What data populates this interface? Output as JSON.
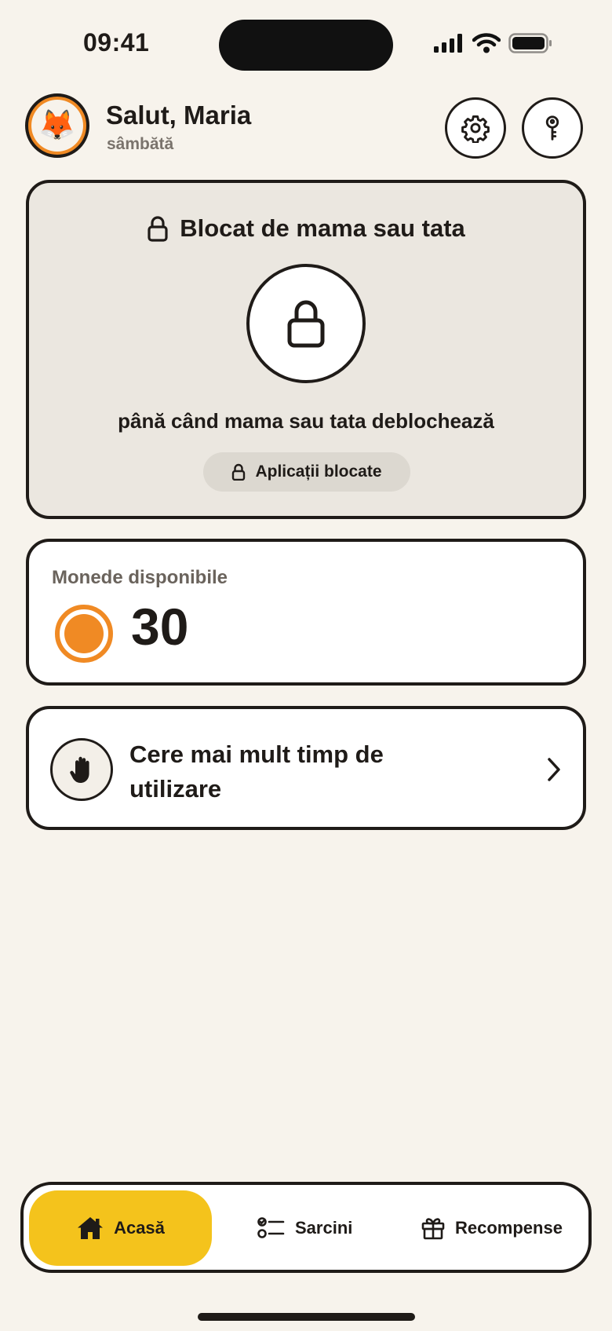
{
  "status_bar": {
    "time": "09:41",
    "icons": [
      "cellular-signal-icon",
      "wifi-icon",
      "battery-icon"
    ]
  },
  "header": {
    "avatar_emoji": "🦊",
    "greeting": "Salut, Maria",
    "day": "sâmbătă",
    "buttons": [
      "settings-icon",
      "key-icon"
    ]
  },
  "lock_card": {
    "title": "Blocat de mama sau tata",
    "message": "până când mama sau tata deblochează",
    "blocked_apps_label": "Aplicații blocate"
  },
  "coins_card": {
    "label": "Monede disponibile",
    "value": "30"
  },
  "request_card": {
    "label": "Cere mai mult timp de utilizare"
  },
  "nav": {
    "home": "Acasă",
    "tasks": "Sarcini",
    "rewards": "Recompense",
    "active": "home"
  },
  "colors": {
    "background": "#f7f3ec",
    "accent_yellow": "#f4c31c",
    "coin_orange": "#f08a24",
    "ink": "#1f1b18"
  }
}
